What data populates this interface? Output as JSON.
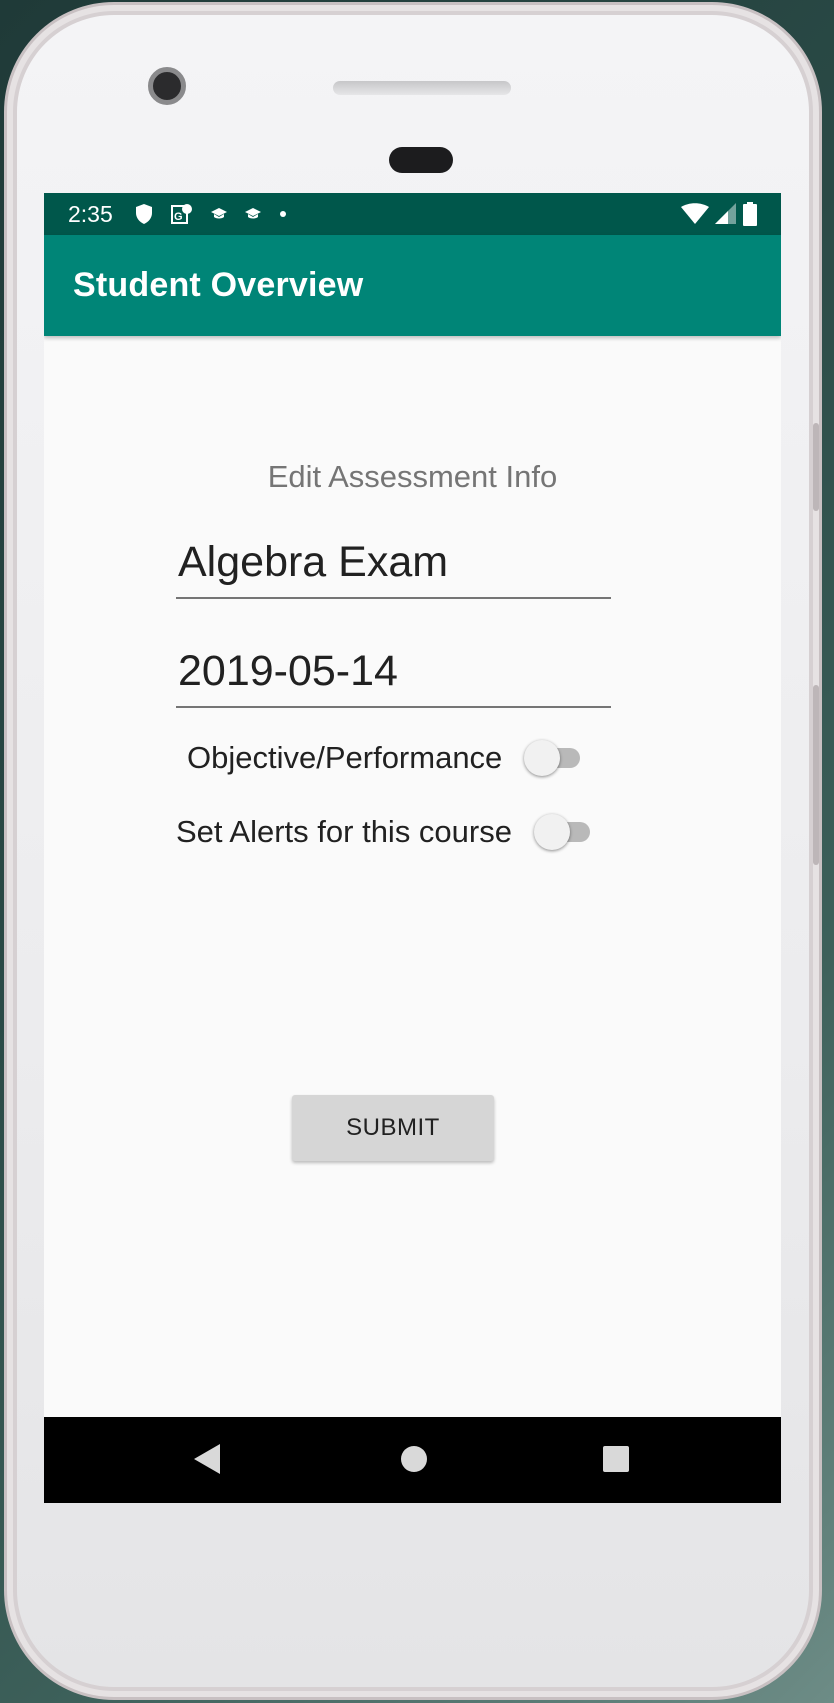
{
  "status_bar": {
    "time": "2:35",
    "icons_left": [
      "shield-icon",
      "map-g-icon",
      "graduation-cap-icon",
      "graduation-cap-icon",
      "dot-icon"
    ],
    "icons_right": [
      "wifi-icon",
      "cell-signal-icon",
      "battery-icon"
    ]
  },
  "app_bar": {
    "title": "Student Overview"
  },
  "form": {
    "section_title": "Edit Assessment Info",
    "assessment_name": "Algebra Exam",
    "assessment_date": "2019-05-14",
    "objective_performance_label": "Objective/Performance",
    "objective_performance_on": false,
    "alerts_label": "Set Alerts for this course",
    "alerts_on": false,
    "submit_label": "SUBMIT"
  },
  "nav_bar": {
    "buttons": [
      "back-icon",
      "home-icon",
      "recents-icon"
    ]
  },
  "colors": {
    "status_bar": "#00574b",
    "app_bar": "#008577",
    "background": "#fafafa",
    "button": "#d6d6d6"
  }
}
